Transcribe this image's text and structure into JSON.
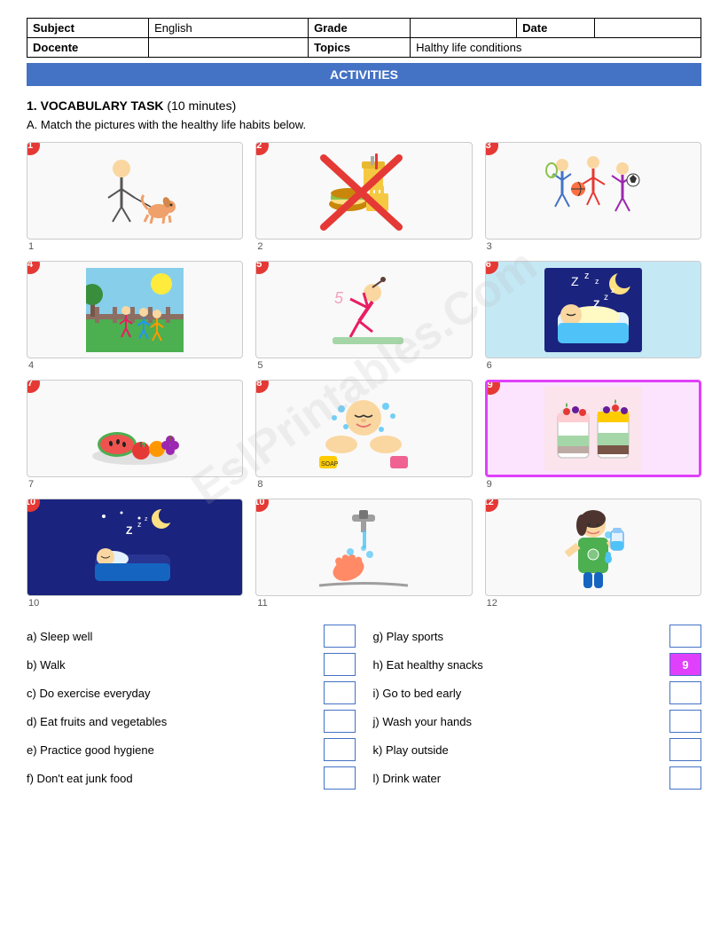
{
  "header": {
    "subject_label": "Subject",
    "subject_value": "English",
    "grade_label": "Grade",
    "grade_value": "",
    "date_label": "Date",
    "date_value": "",
    "docente_label": "Docente",
    "docente_value": "",
    "topics_label": "Topics",
    "topics_value": "Halthy life conditions"
  },
  "banner": "ACTIVITIES",
  "task_title": "1. VOCABULARY TASK",
  "task_time": " (10 minutes)",
  "subtask_label": "A.",
  "subtask_text": "Match the pictures with the healthy life habits below.",
  "images": [
    {
      "id": 1,
      "number": "1",
      "badge": "1",
      "highlighted": false,
      "label": "person walking dog"
    },
    {
      "id": 2,
      "number": "2",
      "badge": "2",
      "highlighted": false,
      "label": "junk food crossed"
    },
    {
      "id": 3,
      "number": "3",
      "badge": "3",
      "highlighted": false,
      "label": "kids playing sports"
    },
    {
      "id": 4,
      "number": "4",
      "badge": "4",
      "highlighted": false,
      "label": "kids playing outside"
    },
    {
      "id": 5,
      "number": "5",
      "badge": "5",
      "highlighted": false,
      "label": "person doing exercise"
    },
    {
      "id": 6,
      "number": "6",
      "badge": "6",
      "highlighted": false,
      "label": "sleeping with zzz"
    },
    {
      "id": 7,
      "number": "7",
      "badge": "7",
      "highlighted": false,
      "label": "fruits and vegetables"
    },
    {
      "id": 8,
      "number": "8",
      "badge": "8",
      "highlighted": false,
      "label": "washing hands/face"
    },
    {
      "id": 9,
      "number": "9",
      "badge": "9",
      "highlighted": true,
      "label": "healthy snacks jars"
    },
    {
      "id": 10,
      "number": "10",
      "badge": "10",
      "highlighted": false,
      "label": "sleeping at night"
    },
    {
      "id": 11,
      "number": "11",
      "badge": "10",
      "highlighted": false,
      "label": "washing hands with water"
    },
    {
      "id": 12,
      "number": "12",
      "badge": "12",
      "highlighted": false,
      "label": "girl drinking water"
    }
  ],
  "answers": {
    "left": [
      {
        "key": "a)",
        "text": "Sleep well",
        "value": ""
      },
      {
        "key": "b)",
        "text": "Walk",
        "value": ""
      },
      {
        "key": "c)",
        "text": "Do exercise everyday",
        "value": ""
      },
      {
        "key": "d)",
        "text": "Eat fruits and vegetables",
        "value": ""
      },
      {
        "key": "e)",
        "text": "Practice good hygiene",
        "value": ""
      },
      {
        "key": "f)",
        "text": "Don't eat junk food",
        "value": ""
      }
    ],
    "right": [
      {
        "key": "g)",
        "text": "Play sports",
        "value": ""
      },
      {
        "key": "h)",
        "text": "Eat healthy snacks",
        "value": "9",
        "filled": true
      },
      {
        "key": "i)",
        "text": "Go to bed early",
        "value": ""
      },
      {
        "key": "j)",
        "text": "Wash your hands",
        "value": ""
      },
      {
        "key": "k)",
        "text": "Play outside",
        "value": ""
      },
      {
        "key": "l)",
        "text": "Drink water",
        "value": ""
      }
    ]
  },
  "watermark": "EslPrintables.Com"
}
